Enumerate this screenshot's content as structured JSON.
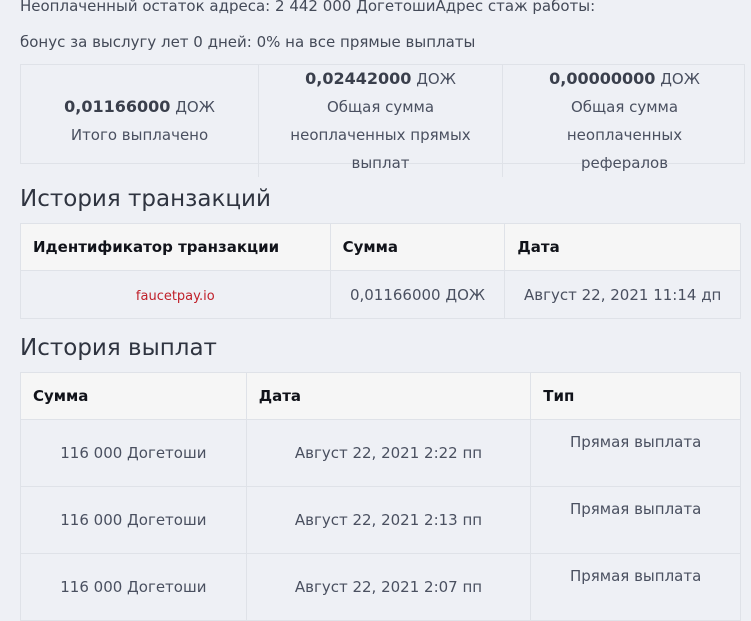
{
  "header": {
    "line1": "Неоплаченный остаток адреса: 2 442 000 ДогетошиАдрес стаж работы:",
    "line2": "бонус за выслугу лет 0 дней: 0% на все прямые выплаты"
  },
  "stats": [
    {
      "value": "0,01166000",
      "unit": "ДОЖ",
      "label": "Итого выплачено"
    },
    {
      "value": "0,02442000",
      "unit": "ДОЖ",
      "label": "Общая сумма неоплаченных прямых выплат"
    },
    {
      "value": "0,00000000",
      "unit": "ДОЖ",
      "label": "Общая сумма неоплаченных рефералов"
    }
  ],
  "transactions": {
    "title": "История транзакций",
    "headers": [
      "Идентификатор транзакции",
      "Сумма",
      "Дата"
    ],
    "rows": [
      {
        "id": "faucetpay.io",
        "amount": "0,01166000 ДОЖ",
        "date": "Август 22, 2021 11:14 дп"
      }
    ]
  },
  "payouts": {
    "title": "История выплат",
    "headers": [
      "Сумма",
      "Дата",
      "Тип"
    ],
    "rows": [
      {
        "amount": "116 000 Догетоши",
        "date": "Август 22, 2021 2:22 пп",
        "type": "Прямая выплата"
      },
      {
        "amount": "116 000 Догетоши",
        "date": "Август 22, 2021 2:13 пп",
        "type": "Прямая выплата"
      },
      {
        "amount": "116 000 Догетоши",
        "date": "Август 22, 2021 2:07 пп",
        "type": "Прямая выплата"
      }
    ]
  },
  "colors": {
    "link": "#c0202a",
    "header_bg": "#f6f6f6",
    "page_bg": "#eef0f5"
  }
}
